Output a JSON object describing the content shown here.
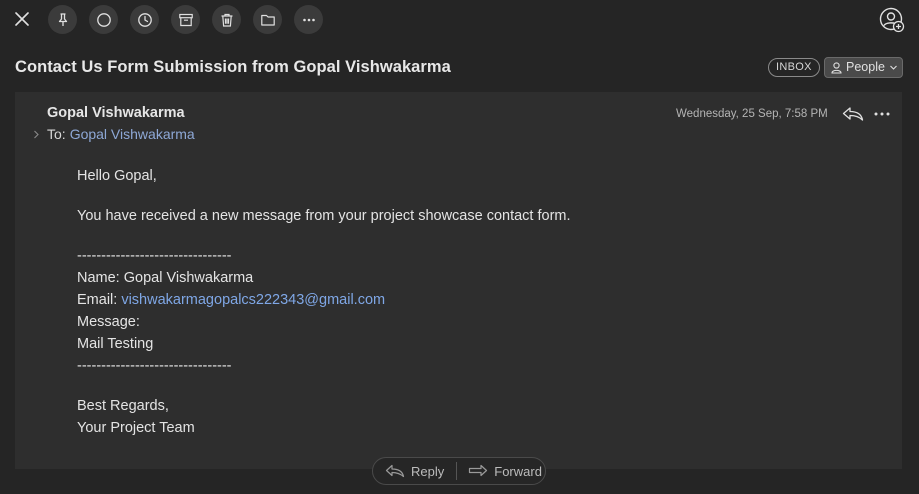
{
  "toolbar": {
    "close_icon": "close-icon",
    "buttons": [
      {
        "name": "pin-icon"
      },
      {
        "name": "mark-unread-icon"
      },
      {
        "name": "snooze-icon"
      },
      {
        "name": "archive-icon"
      },
      {
        "name": "trash-icon"
      },
      {
        "name": "move-folder-icon"
      },
      {
        "name": "more-icon"
      }
    ],
    "account_icon": "add-account-icon"
  },
  "message": {
    "subject": "Contact Us Form Submission from Gopal Vishwakarma",
    "folder_badge": "INBOX",
    "people_label": "People",
    "sender": "Gopal Vishwakarma",
    "to_label": "To:",
    "to_value": "Gopal Vishwakarma",
    "timestamp": "Wednesday, 25 Sep, 7:58 PM",
    "body": {
      "greeting": "Hello Gopal,",
      "intro": "You have received a new message from your project showcase contact form.",
      "separator": "--------------------------------",
      "name_line": "Name: Gopal Vishwakarma",
      "email_label": "Email: ",
      "email_value": "vishwakarmagopalcs222343@gmail.com",
      "message_label": "Message:",
      "message_value": "Mail Testing",
      "separator_end": "--------------------------------",
      "closing": "Best Regards,",
      "signature": "Your Project Team"
    }
  },
  "actions": {
    "reply_label": "Reply",
    "forward_label": "Forward"
  },
  "colors": {
    "background": "#252525",
    "card": "#2e2e2e",
    "link": "#7fa7e6",
    "recipient": "#8ea8d6"
  }
}
